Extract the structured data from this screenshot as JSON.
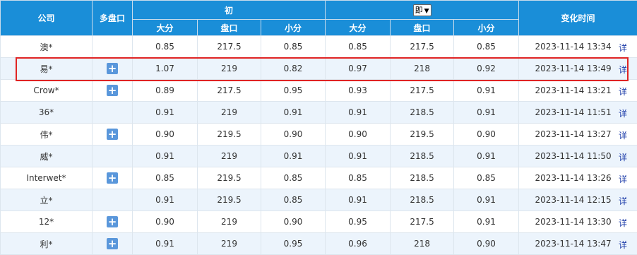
{
  "header": {
    "company": "公司",
    "multi": "多盘口",
    "initial": "初",
    "live_select": "即",
    "change_time": "变化时间",
    "sub": [
      "大分",
      "盘口",
      "小分",
      "大分",
      "盘口",
      "小分"
    ]
  },
  "detail_label": "详",
  "plus_symbol": "+",
  "colors": {
    "header_bg": "#1a8ed8",
    "alt_row": "#ecf4fc",
    "live_value": "#1a3aa8",
    "highlight": "#e02424"
  },
  "rows": [
    {
      "company": "澳*",
      "multi": false,
      "i_big": "0.85",
      "i_line": "217.5",
      "i_small": "0.85",
      "l_big": "0.85",
      "l_line": "217.5",
      "l_small": "0.85",
      "time": "2023-11-14 13:34"
    },
    {
      "company": "易*",
      "multi": true,
      "i_big": "1.07",
      "i_line": "219",
      "i_small": "0.82",
      "l_big": "0.97",
      "l_line": "218",
      "l_small": "0.92",
      "time": "2023-11-14 13:49",
      "highlighted": true
    },
    {
      "company": "Crow*",
      "multi": true,
      "i_big": "0.89",
      "i_line": "217.5",
      "i_small": "0.95",
      "l_big": "0.93",
      "l_line": "217.5",
      "l_small": "0.91",
      "time": "2023-11-14 13:21"
    },
    {
      "company": "36*",
      "multi": false,
      "i_big": "0.91",
      "i_line": "219",
      "i_small": "0.91",
      "l_big": "0.91",
      "l_line": "218.5",
      "l_small": "0.91",
      "time": "2023-11-14 11:51"
    },
    {
      "company": "伟*",
      "multi": true,
      "i_big": "0.90",
      "i_line": "219.5",
      "i_small": "0.90",
      "l_big": "0.90",
      "l_line": "219.5",
      "l_small": "0.90",
      "time": "2023-11-14 13:27"
    },
    {
      "company": "威*",
      "multi": false,
      "i_big": "0.91",
      "i_line": "219",
      "i_small": "0.91",
      "l_big": "0.91",
      "l_line": "218.5",
      "l_small": "0.91",
      "time": "2023-11-14 11:50"
    },
    {
      "company": "Interwet*",
      "multi": true,
      "i_big": "0.85",
      "i_line": "219.5",
      "i_small": "0.85",
      "l_big": "0.85",
      "l_line": "218.5",
      "l_small": "0.85",
      "time": "2023-11-14 13:26"
    },
    {
      "company": "立*",
      "multi": false,
      "i_big": "0.91",
      "i_line": "219.5",
      "i_small": "0.85",
      "l_big": "0.91",
      "l_line": "218.5",
      "l_small": "0.91",
      "time": "2023-11-14 12:15"
    },
    {
      "company": "12*",
      "multi": true,
      "i_big": "0.90",
      "i_line": "219",
      "i_small": "0.90",
      "l_big": "0.95",
      "l_line": "217.5",
      "l_small": "0.91",
      "time": "2023-11-14 13:30"
    },
    {
      "company": "利*",
      "multi": true,
      "i_big": "0.91",
      "i_line": "219",
      "i_small": "0.95",
      "l_big": "0.96",
      "l_line": "218",
      "l_small": "0.90",
      "time": "2023-11-14 13:47"
    }
  ]
}
